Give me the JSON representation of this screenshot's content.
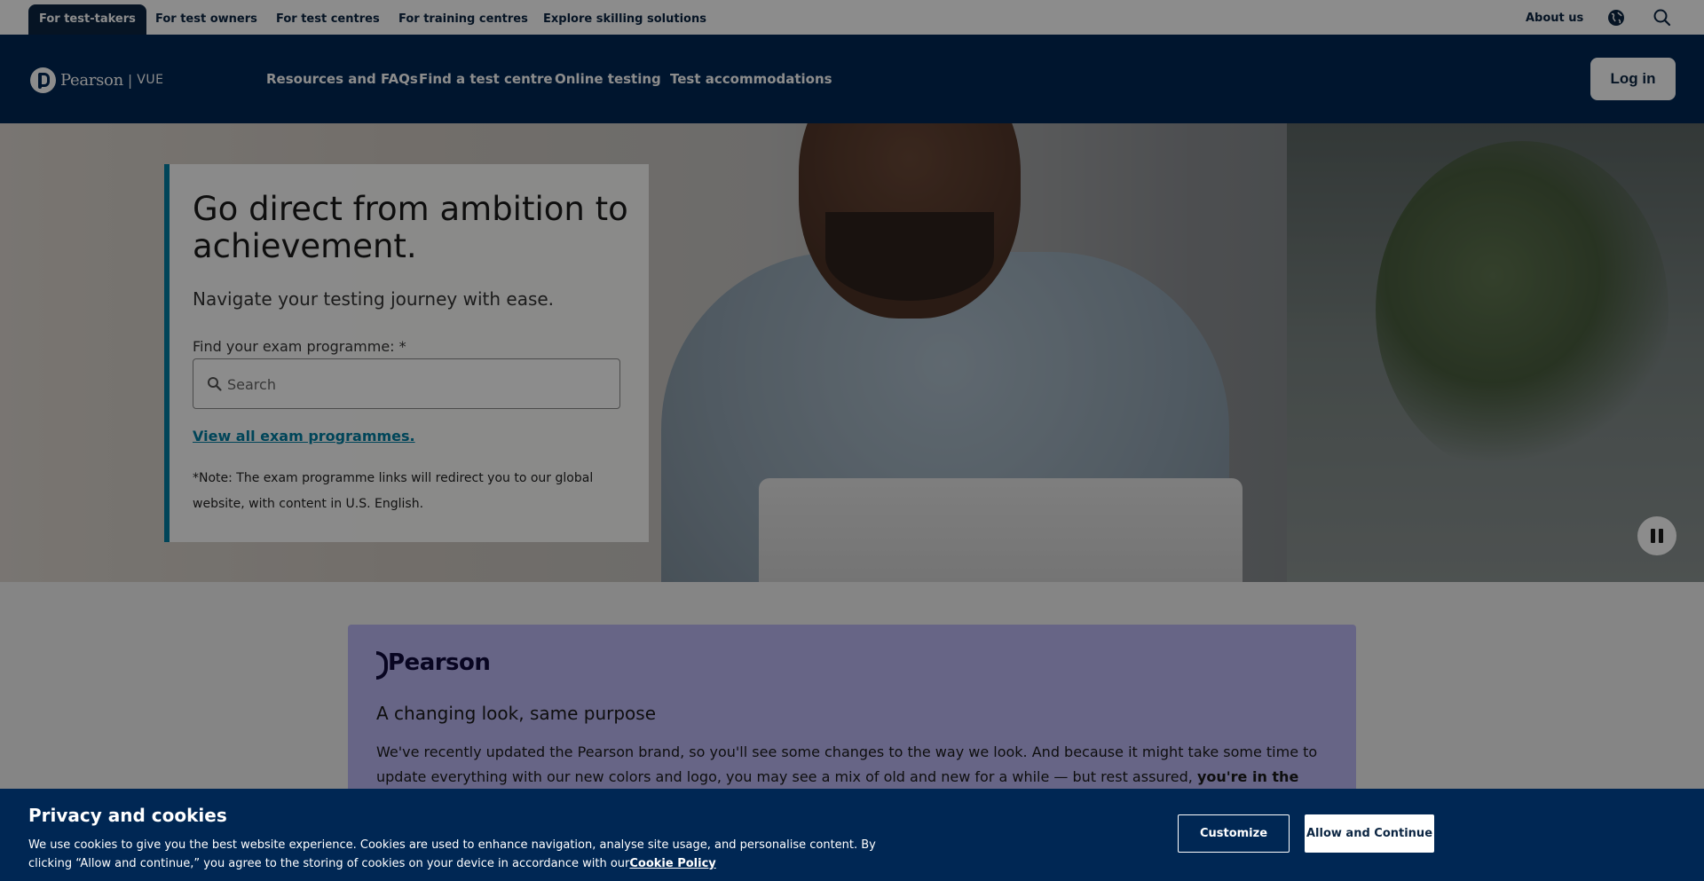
{
  "topbar": {
    "tabs": [
      {
        "label": "For test-takers",
        "active": true
      },
      {
        "label": "For test owners",
        "active": false
      },
      {
        "label": "For test centres",
        "active": false
      },
      {
        "label": "For training centres",
        "active": false
      },
      {
        "label": "Explore skilling solutions",
        "active": false
      }
    ],
    "about_label": "About us",
    "globe_icon": "globe-icon",
    "search_icon": "search-icon"
  },
  "header": {
    "logo": {
      "brand": "Pearson",
      "separator": "|",
      "product": "VUE"
    },
    "nav": [
      {
        "label": "Resources and FAQs"
      },
      {
        "label": "Find a test centre"
      },
      {
        "label": "Online testing"
      },
      {
        "label": "Test accommodations"
      }
    ],
    "login_label": "Log in"
  },
  "hero": {
    "title": "Go direct from ambition to achievement.",
    "subtitle": "Navigate your testing journey with ease.",
    "field_label": "Find your exam programme: *",
    "search_placeholder": "Search",
    "search_value": "",
    "view_all_label": "View all exam programmes.",
    "note": "*Note: The exam programme links will redirect you to our global website, with content in U.S. English.",
    "pause_icon": "pause-icon"
  },
  "rebrand": {
    "logo_word": "Pearson",
    "heading": "A changing look, same purpose",
    "body": "We've recently updated the Pearson brand, so you'll see some changes to the way we look. And because it might take some time to update everything with our new colors and logo, you may see a mix of old and new for a while — but rest assured, ",
    "body_bold": "you're in the right place!"
  },
  "cookie_banner": {
    "title": "Privacy and cookies",
    "text": "We use cookies to give you the best website experience. Cookies are used to enhance navigation, analyse site usage, and personalise content. By clicking “Allow and continue,” you agree to the storing of cookies on your device in accordance with our",
    "policy_link": "Cookie Policy",
    "customize_label": "Customize",
    "allow_label": "Allow and Continue"
  },
  "colors": {
    "navy": "#002754",
    "teal_accent": "#007fa3",
    "rebrand_lavender": "#bcb8f4"
  }
}
